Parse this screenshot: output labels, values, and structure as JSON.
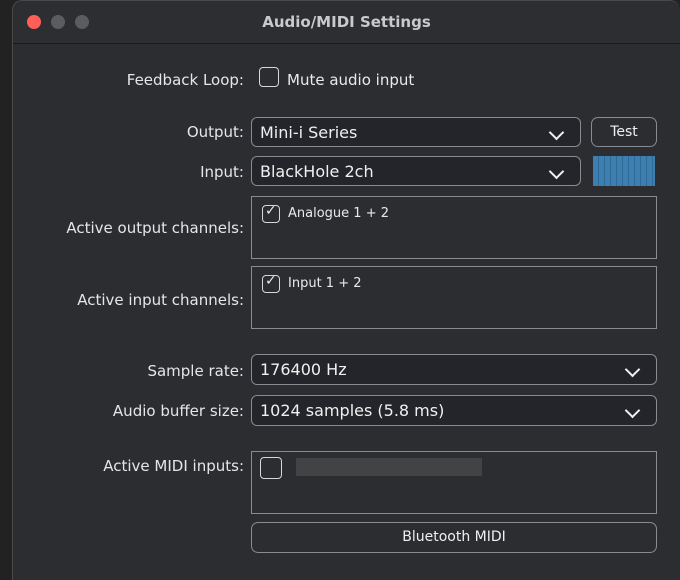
{
  "window": {
    "title": "Audio/MIDI Settings"
  },
  "feedback": {
    "label": "Feedback Loop:",
    "checkbox_label": "Mute audio input",
    "checked": false
  },
  "output": {
    "label": "Output:",
    "value": "Mini-i Series",
    "test_label": "Test"
  },
  "input": {
    "label": "Input:",
    "value": "BlackHole 2ch"
  },
  "active_output": {
    "label": "Active output channels:",
    "items": [
      {
        "label": "Analogue 1 + 2",
        "checked": true
      }
    ]
  },
  "active_input": {
    "label": "Active input channels:",
    "items": [
      {
        "label": "Input 1 + 2",
        "checked": true
      }
    ]
  },
  "sample_rate": {
    "label": "Sample rate:",
    "value": "176400 Hz"
  },
  "buffer_size": {
    "label": "Audio buffer size:",
    "value": "1024 samples (5.8 ms)"
  },
  "midi": {
    "label": "Active MIDI inputs:",
    "items": [
      {
        "checked": false
      }
    ],
    "bluetooth_label": "Bluetooth MIDI"
  },
  "colors": {
    "close": "#ff5f57",
    "meter": "#3d7fb0",
    "background": "#2b2d31"
  }
}
